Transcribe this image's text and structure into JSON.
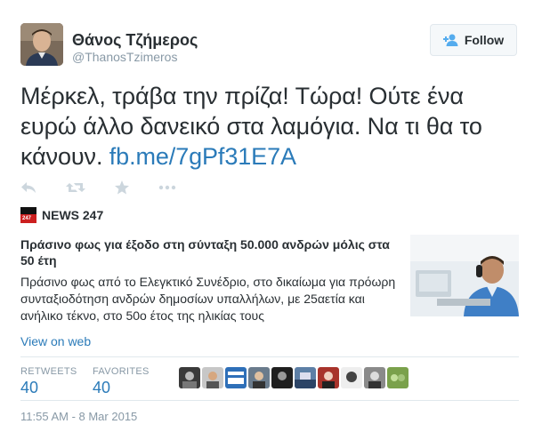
{
  "author": {
    "name": "Θάνος Τζήμερος",
    "handle": "@ThanosTzimeros"
  },
  "follow_button": {
    "label": "Follow",
    "icon": "follow-person-plus-icon"
  },
  "tweet": {
    "text": "Μέρκελ, τράβα την πρίζα! Τώρα! Ούτε ένα ευρώ άλλο δανεικό στα λαμόγια. Να τι θα το κάνουν. ",
    "link": "fb.me/7gPf31E7A"
  },
  "actions": {
    "icons": [
      "reply-icon",
      "retweet-icon",
      "favorite-star-icon",
      "more-dots-icon"
    ]
  },
  "card": {
    "source_name": "NEWS 247",
    "source_logo_text": "247",
    "title": "Πράσινο φως για έξοδο στη σύνταξη 50.000 ανδρών μόλις στα 50 έτη",
    "description": "Πράσινο φως από το Ελεγκτικό Συνέδριο, στο δικαίωμα για πρόωρη συνταξιοδότηση ανδρών δημοσίων υπαλλήλων, με 25αετία και ανήλικο τέκνο, στο 50ο έτος της ηλικίας τους",
    "view_on_web": "View on web"
  },
  "stats": {
    "retweets_label": "RETWEETS",
    "retweets_value": "40",
    "favorites_label": "FAVORITES",
    "favorites_value": "40"
  },
  "favoriters_count_shown": 10,
  "timestamp": "11:55 AM - 8 Mar 2015",
  "colors": {
    "link": "#2b7bb9",
    "text": "#292f33",
    "muted": "#8899a6",
    "border": "#e1e8ed"
  }
}
